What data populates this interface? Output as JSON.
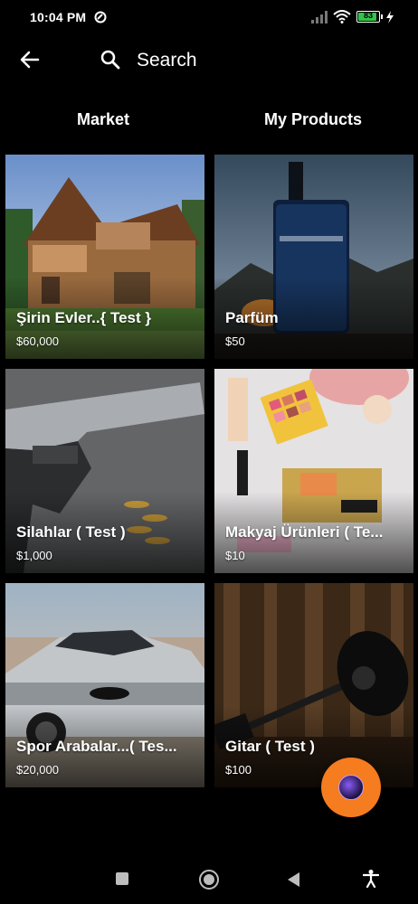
{
  "status_bar": {
    "time": "10:04 PM",
    "battery": "83",
    "icons": [
      "app-notification-icon",
      "signal-icon",
      "wifi-icon",
      "battery-icon",
      "charging-icon"
    ]
  },
  "app_bar": {
    "back_icon": "arrow-left-icon",
    "search_icon": "search-icon",
    "search_label": "Search"
  },
  "tabs": [
    {
      "label": "Market"
    },
    {
      "label": "My Products"
    }
  ],
  "products": [
    {
      "title": "Şirin Evler..{ Test }",
      "price": "$60,000"
    },
    {
      "title": "Parfüm",
      "price": "$50"
    },
    {
      "title": "Silahlar ( Test )",
      "price": "$1,000"
    },
    {
      "title": "Makyaj Ürünleri ( Te...",
      "price": "$10"
    },
    {
      "title": "Spor Arabalar...( Tes...",
      "price": "$20,000"
    },
    {
      "title": "Gitar ( Test )",
      "price": "$100"
    }
  ],
  "colors": {
    "background": "#000000",
    "fab": "#f57c1f",
    "battery": "#35c24a"
  },
  "nav_bar": {
    "icons": [
      "recents-square-icon",
      "home-circle-icon",
      "back-triangle-icon",
      "accessibility-icon"
    ]
  }
}
